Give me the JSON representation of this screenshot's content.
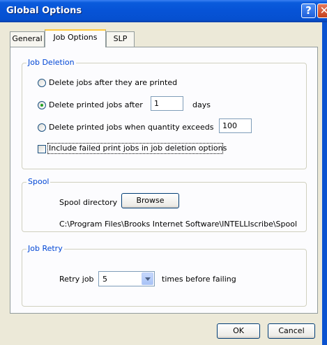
{
  "window": {
    "title": "Global Options",
    "help_glyph": "?",
    "close_glyph": "✕"
  },
  "tabs": [
    {
      "label": "General",
      "active": false
    },
    {
      "label": "Job Options",
      "active": true
    },
    {
      "label": "SLP",
      "active": false
    }
  ],
  "job_deletion": {
    "legend": "Job Deletion",
    "option_after_printed": "Delete jobs after they are printed",
    "option_after_days": "Delete printed jobs after",
    "days_value": "1",
    "days_unit": "days",
    "option_quantity": "Delete printed jobs when quantity exceeds",
    "quantity_value": "100",
    "include_failed": "Include failed print jobs in job deletion options",
    "selected": "after_days"
  },
  "spool": {
    "legend": "Spool",
    "directory_label": "Spool directory",
    "browse_label": "Browse",
    "path": "C:\\Program Files\\Brooks Internet Software\\INTELLIscribe\\Spool"
  },
  "job_retry": {
    "legend": "Job Retry",
    "retry_label": "Retry job",
    "retry_value": "5",
    "suffix": "times before failing"
  },
  "buttons": {
    "ok": "OK",
    "cancel": "Cancel"
  }
}
